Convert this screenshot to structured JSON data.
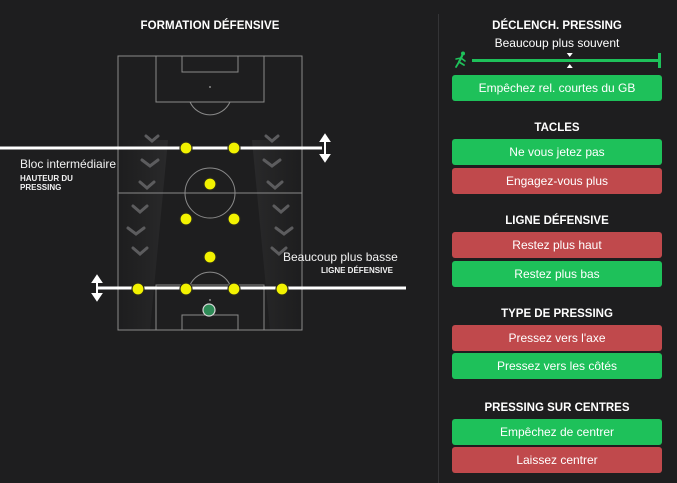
{
  "formation": {
    "title": "FORMATION DÉFENSIVE",
    "block_line": {
      "label": "Bloc intermédiaire",
      "sublabel_1": "HAUTEUR DU",
      "sublabel_2": "PRESSING"
    },
    "defensive_line": {
      "label": "Beaucoup plus basse",
      "sublabel": "LIGNE DÉFENSIVE"
    }
  },
  "colors": {
    "background": "#1e1e1f",
    "green": "#1ec15a",
    "red": "#c0494c",
    "player": "#f2f200",
    "goalkeeper": "#2e8b57",
    "pitch_line": "#8a8a8a"
  },
  "pressing_trigger": {
    "title": "DÉCLENCH. PRESSING",
    "value_label": "Beaucoup plus souvent",
    "slider_level": 0.52,
    "icon": "running-player-icon",
    "button": "Empêchez rel. courtes du GB"
  },
  "tackles": {
    "title": "TACLES",
    "options": [
      {
        "label": "Ne vous jetez pas",
        "color": "green"
      },
      {
        "label": "Engagez-vous plus",
        "color": "red"
      }
    ]
  },
  "defensive_line_panel": {
    "title": "LIGNE DÉFENSIVE",
    "options": [
      {
        "label": "Restez plus haut",
        "color": "red"
      },
      {
        "label": "Restez plus bas",
        "color": "green"
      }
    ]
  },
  "pressing_type": {
    "title": "TYPE DE PRESSING",
    "options": [
      {
        "label": "Pressez vers l'axe",
        "color": "red"
      },
      {
        "label": "Pressez vers les côtés",
        "color": "green"
      }
    ]
  },
  "cross_pressing": {
    "title": "PRESSING SUR CENTRES",
    "options": [
      {
        "label": "Empêchez de centrer",
        "color": "green"
      },
      {
        "label": "Laissez centrer",
        "color": "red"
      }
    ]
  }
}
